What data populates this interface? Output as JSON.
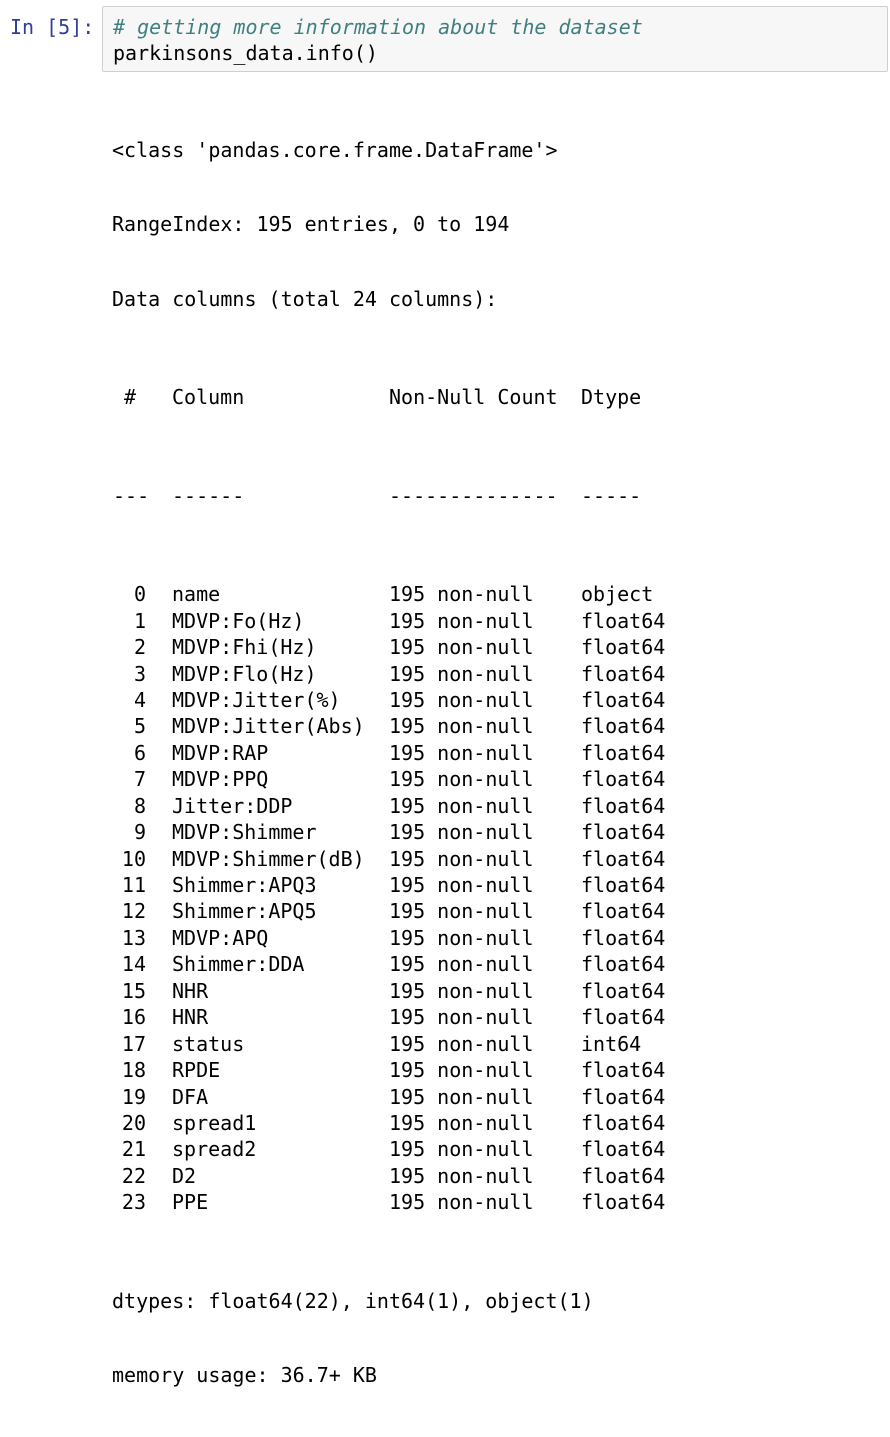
{
  "cell": {
    "prompt": "In [5]:",
    "code_comment": "# getting more information about the dataset",
    "code_call": "parkinsons_data.info()"
  },
  "output": {
    "class_line": "<class 'pandas.core.frame.DataFrame'>",
    "range_index": "RangeIndex: 195 entries, 0 to 194",
    "data_columns": "Data columns (total 24 columns):",
    "header": {
      "idx": "#",
      "column": "Column",
      "count": "Non-Null Count",
      "dtype": "Dtype"
    },
    "separator": {
      "idx": "---",
      "column": "------",
      "count": "--------------",
      "dtype": "-----"
    },
    "rows": [
      {
        "idx": "0",
        "column": "name",
        "count": "195 non-null",
        "dtype": "object"
      },
      {
        "idx": "1",
        "column": "MDVP:Fo(Hz)",
        "count": "195 non-null",
        "dtype": "float64"
      },
      {
        "idx": "2",
        "column": "MDVP:Fhi(Hz)",
        "count": "195 non-null",
        "dtype": "float64"
      },
      {
        "idx": "3",
        "column": "MDVP:Flo(Hz)",
        "count": "195 non-null",
        "dtype": "float64"
      },
      {
        "idx": "4",
        "column": "MDVP:Jitter(%)",
        "count": "195 non-null",
        "dtype": "float64"
      },
      {
        "idx": "5",
        "column": "MDVP:Jitter(Abs)",
        "count": "195 non-null",
        "dtype": "float64"
      },
      {
        "idx": "6",
        "column": "MDVP:RAP",
        "count": "195 non-null",
        "dtype": "float64"
      },
      {
        "idx": "7",
        "column": "MDVP:PPQ",
        "count": "195 non-null",
        "dtype": "float64"
      },
      {
        "idx": "8",
        "column": "Jitter:DDP",
        "count": "195 non-null",
        "dtype": "float64"
      },
      {
        "idx": "9",
        "column": "MDVP:Shimmer",
        "count": "195 non-null",
        "dtype": "float64"
      },
      {
        "idx": "10",
        "column": "MDVP:Shimmer(dB)",
        "count": "195 non-null",
        "dtype": "float64"
      },
      {
        "idx": "11",
        "column": "Shimmer:APQ3",
        "count": "195 non-null",
        "dtype": "float64"
      },
      {
        "idx": "12",
        "column": "Shimmer:APQ5",
        "count": "195 non-null",
        "dtype": "float64"
      },
      {
        "idx": "13",
        "column": "MDVP:APQ",
        "count": "195 non-null",
        "dtype": "float64"
      },
      {
        "idx": "14",
        "column": "Shimmer:DDA",
        "count": "195 non-null",
        "dtype": "float64"
      },
      {
        "idx": "15",
        "column": "NHR",
        "count": "195 non-null",
        "dtype": "float64"
      },
      {
        "idx": "16",
        "column": "HNR",
        "count": "195 non-null",
        "dtype": "float64"
      },
      {
        "idx": "17",
        "column": "status",
        "count": "195 non-null",
        "dtype": "int64"
      },
      {
        "idx": "18",
        "column": "RPDE",
        "count": "195 non-null",
        "dtype": "float64"
      },
      {
        "idx": "19",
        "column": "DFA",
        "count": "195 non-null",
        "dtype": "float64"
      },
      {
        "idx": "20",
        "column": "spread1",
        "count": "195 non-null",
        "dtype": "float64"
      },
      {
        "idx": "21",
        "column": "spread2",
        "count": "195 non-null",
        "dtype": "float64"
      },
      {
        "idx": "22",
        "column": "D2",
        "count": "195 non-null",
        "dtype": "float64"
      },
      {
        "idx": "23",
        "column": "PPE",
        "count": "195 non-null",
        "dtype": "float64"
      }
    ],
    "dtypes_line": "dtypes: float64(22), int64(1), object(1)",
    "memory_line": "memory usage: 36.7+ KB"
  },
  "colors": {
    "prompt": "#303f9f",
    "comment": "#408080",
    "input_bg": "#f7f7f7",
    "input_border": "#cfcfcf"
  }
}
